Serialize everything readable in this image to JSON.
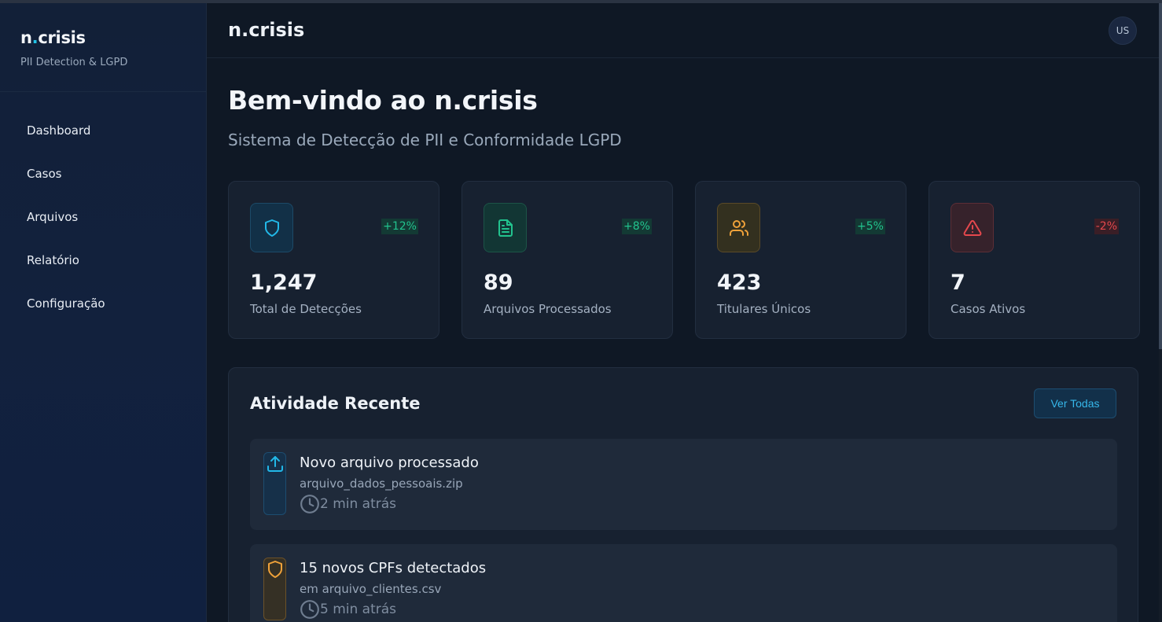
{
  "brand": {
    "name": "n.crisis",
    "name_prefix": "n",
    "name_dot": ".",
    "name_suffix": "crisis",
    "subtitle": "PII Detection & LGPD"
  },
  "nav": [
    {
      "label": "Dashboard"
    },
    {
      "label": "Casos"
    },
    {
      "label": "Arquivos"
    },
    {
      "label": "Relatório"
    },
    {
      "label": "Configuração"
    }
  ],
  "header": {
    "title": "n.crisis",
    "avatar": "US"
  },
  "welcome": {
    "title": "Bem-vindo ao n.crisis",
    "subtitle": "Sistema de Detecção de PII e Conformidade LGPD"
  },
  "stats": [
    {
      "icon": "shield-icon",
      "value": "1,247",
      "label": "Total de Detecções",
      "change": "+12%",
      "color": "#22b8e8"
    },
    {
      "icon": "document-icon",
      "value": "89",
      "label": "Arquivos Processados",
      "change": "+8%",
      "color": "#22c38e"
    },
    {
      "icon": "users-icon",
      "value": "423",
      "label": "Titulares Únicos",
      "change": "+5%",
      "color": "#f0a23a"
    },
    {
      "icon": "alert-triangle-icon",
      "value": "7",
      "label": "Casos Ativos",
      "change": "-2%",
      "color": "#e5484d"
    }
  ],
  "activity": {
    "title": "Atividade Recente",
    "view_all": "Ver Todas",
    "items": [
      {
        "icon": "upload-icon",
        "title": "Novo arquivo processado",
        "detail": "arquivo_dados_pessoais.zip",
        "time": "2 min atrás",
        "color": "#22b8e8"
      },
      {
        "icon": "shield-icon",
        "title": "15 novos CPFs detectados",
        "detail": "em arquivo_clientes.csv",
        "time": "5 min atrás",
        "color": "#f0a23a"
      }
    ]
  }
}
